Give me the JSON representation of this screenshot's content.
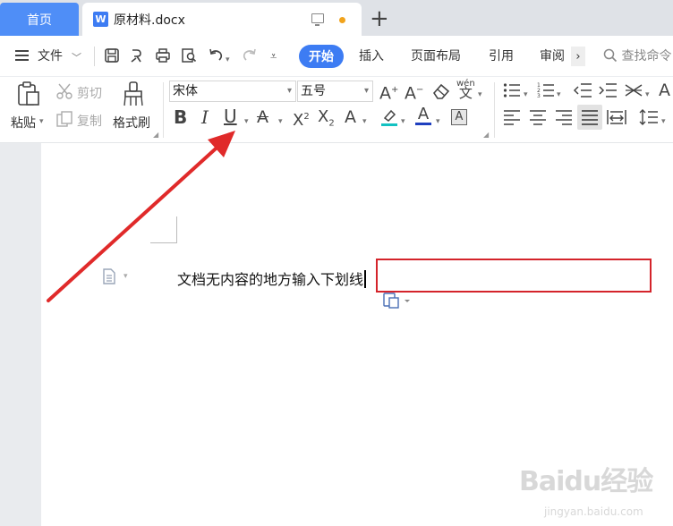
{
  "tabs": {
    "home": "首页",
    "doc_icon_letter": "W",
    "doc_title": "原材料.docx",
    "add": "+"
  },
  "menu": {
    "file": "文件",
    "start": "开始",
    "insert": "插入",
    "layout": "页面布局",
    "reference": "引用",
    "review": "审阅",
    "search_placeholder": "查找命令"
  },
  "ribbon": {
    "paste": "粘贴",
    "cut": "剪切",
    "copy": "复制",
    "format_painter": "格式刷",
    "font_name": "宋体",
    "font_size": "五号",
    "phonetic": "wén"
  },
  "document": {
    "text": "文档无内容的地方输入下划线"
  },
  "watermark": {
    "brand": "Baidu经验",
    "url": "jingyan.baidu.com"
  },
  "colors": {
    "accent": "#3d7cf3",
    "home_tab": "#4f8ef7",
    "annotation_red": "#d4242b",
    "highlight_cyan": "#13c2c2",
    "font_color_blue": "#1f3fbf"
  }
}
